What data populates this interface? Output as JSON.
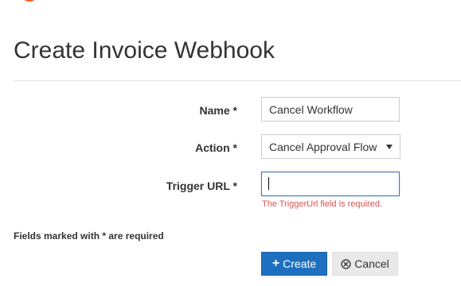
{
  "page": {
    "title": "Create Invoice Webhook"
  },
  "form": {
    "name": {
      "label": "Name *",
      "value": "Cancel Workflow"
    },
    "action": {
      "label": "Action *",
      "selected": "Cancel Approval Flow"
    },
    "trigger_url": {
      "label": "Trigger URL *",
      "value": "",
      "error": "The TriggerUrl field is required."
    },
    "required_note": "Fields marked with * are required"
  },
  "buttons": {
    "create_label": "Create",
    "create_icon": "plus-icon",
    "cancel_label": "Cancel",
    "cancel_icon": "cancel-circle-icon"
  },
  "colors": {
    "primary": "#1e6fbf",
    "error": "#d9534f",
    "focus_border": "#3c73b4",
    "brand_accent": "#f26522"
  }
}
